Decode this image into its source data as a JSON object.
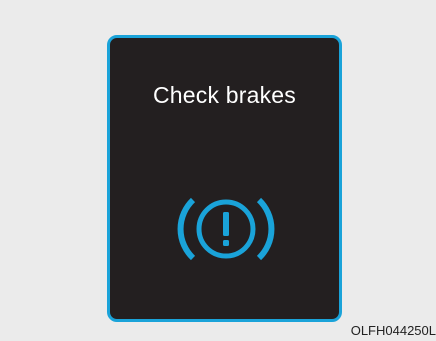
{
  "warning": {
    "message": "Check brakes",
    "icon": "brake-warning-icon",
    "accent_color": "#1aa3d9",
    "panel_color": "#231f20"
  },
  "figure_code": "OLFH044250L"
}
